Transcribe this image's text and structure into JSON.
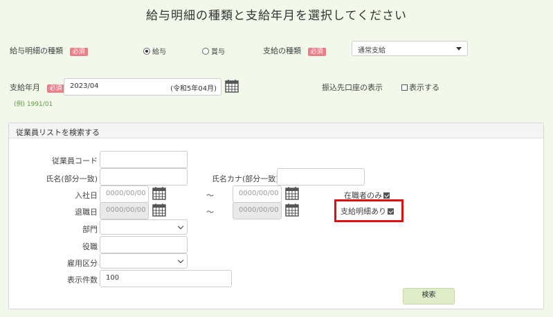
{
  "page": {
    "title": "給与明細の種類と支給年月を選択してください"
  },
  "form": {
    "payslip_type_label": "給与明細の種類",
    "required": "必須",
    "radio_salary": "給与",
    "radio_bonus": "賞与",
    "payment_type_label": "支給の種類",
    "payment_type_value": "通常支給",
    "pay_month_label": "支給年月",
    "pay_month_value": "2023/04",
    "pay_month_era": "(令和5年04月)",
    "pay_month_example": "(例) 1991/01",
    "bank_display_label": "振込先口座の表示",
    "bank_display_checkbox": "表示する"
  },
  "search": {
    "header": "従業員リストを検索する",
    "employee_code_label": "従業員コード",
    "name_label": "氏名(部分一致)",
    "name_kana_label": "氏名カナ(部分一致)",
    "hire_date_label": "入社日",
    "retire_date_label": "退職日",
    "date_placeholder": "0000/00/00",
    "range_sep": "～",
    "employed_only_label": "在職者のみ",
    "has_payslip_label": "支給明細あり",
    "department_label": "部門",
    "position_label": "役職",
    "employment_type_label": "雇用区分",
    "display_count_label": "表示件数",
    "display_count_value": "100",
    "search_button": "検索"
  }
}
